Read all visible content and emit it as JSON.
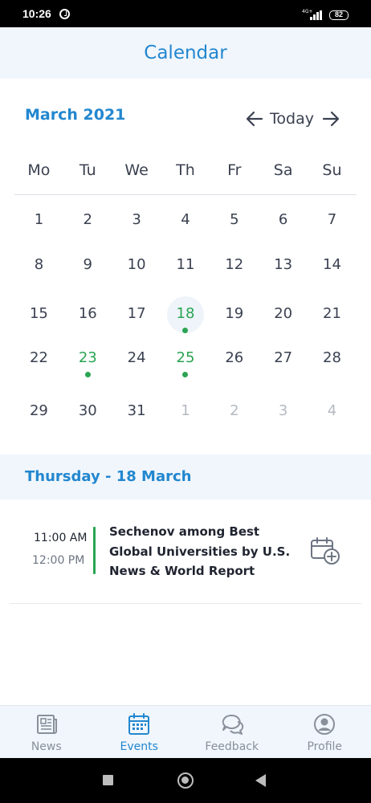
{
  "status_bar": {
    "time": "10:26",
    "network": "4G+",
    "battery": "82"
  },
  "header": {
    "title": "Calendar"
  },
  "calendar": {
    "month_title": "March 2021",
    "today_label": "Today",
    "weekdays": [
      "Mo",
      "Tu",
      "We",
      "Th",
      "Fr",
      "Sa",
      "Su"
    ],
    "weeks": [
      [
        {
          "d": "1"
        },
        {
          "d": "2"
        },
        {
          "d": "3"
        },
        {
          "d": "4"
        },
        {
          "d": "5"
        },
        {
          "d": "6"
        },
        {
          "d": "7"
        }
      ],
      [
        {
          "d": "8"
        },
        {
          "d": "9"
        },
        {
          "d": "10"
        },
        {
          "d": "11"
        },
        {
          "d": "12"
        },
        {
          "d": "13"
        },
        {
          "d": "14"
        }
      ],
      [
        {
          "d": "15"
        },
        {
          "d": "16"
        },
        {
          "d": "17"
        },
        {
          "d": "18",
          "selected": true,
          "event": true
        },
        {
          "d": "19"
        },
        {
          "d": "20"
        },
        {
          "d": "21"
        }
      ],
      [
        {
          "d": "22"
        },
        {
          "d": "23",
          "event": true
        },
        {
          "d": "24"
        },
        {
          "d": "25",
          "event": true
        },
        {
          "d": "26"
        },
        {
          "d": "27"
        },
        {
          "d": "28"
        }
      ],
      [
        {
          "d": "29"
        },
        {
          "d": "30"
        },
        {
          "d": "31"
        },
        {
          "d": "1",
          "other": true
        },
        {
          "d": "2",
          "other": true
        },
        {
          "d": "3",
          "other": true
        },
        {
          "d": "4",
          "other": true
        }
      ]
    ]
  },
  "selected_day": {
    "title": "Thursday - 18 March"
  },
  "event": {
    "start": "11:00 AM",
    "end": "12:00 PM",
    "title": "Sechenov among Best Global Universities by U.S. News & World Report"
  },
  "bottom_nav": {
    "tabs": [
      {
        "label": "News",
        "icon": "newspaper-icon",
        "active": false
      },
      {
        "label": "Events",
        "icon": "calendar-icon",
        "active": true
      },
      {
        "label": "Feedback",
        "icon": "chat-bubbles-icon",
        "active": false
      },
      {
        "label": "Profile",
        "icon": "user-circle-icon",
        "active": false
      }
    ]
  },
  "colors": {
    "accent": "#2287cf",
    "event_green": "#2aa452",
    "header_bg": "#f0f6fc",
    "text": "#3a4150",
    "muted": "#b4b9c1"
  }
}
